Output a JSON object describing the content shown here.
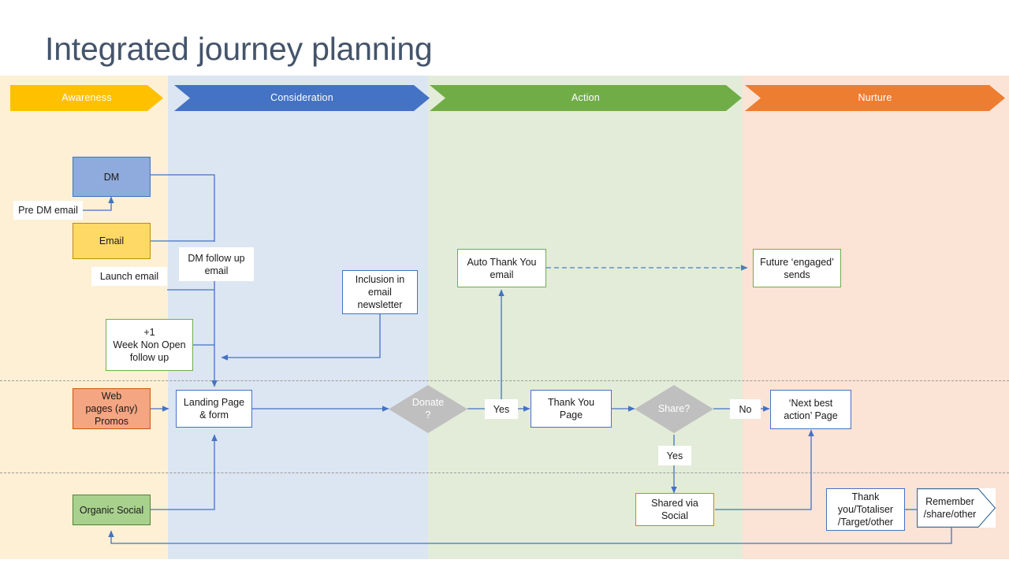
{
  "page": {
    "title": "Integrated journey planning",
    "title_color": "#44546a"
  },
  "phases": [
    {
      "label": "Awareness",
      "color": "#ffc000",
      "band_color": "#fdf0d4"
    },
    {
      "label": "Consideration",
      "color": "#4472c4",
      "band_color": "#dce6f2"
    },
    {
      "label": "Action",
      "color": "#70ad47",
      "band_color": "#e3ecd9"
    },
    {
      "label": "Nurture",
      "color": "#ed7d31",
      "band_color": "#fbe3d5"
    }
  ],
  "nodes": {
    "dm": "DM",
    "pre_dm_email": "Pre DM email",
    "email": "Email",
    "launch_email": "Launch email",
    "dm_follow_up_email": "DM follow up\nemail",
    "week_non_open": "+1\nWeek Non Open\nfollow up",
    "inclusion_newsletter": "Inclusion in\nemail\nnewsletter",
    "auto_thank_you_email": "Auto Thank You\nemail",
    "future_engaged_sends": "Future ‘engaged’\nsends",
    "web_pages_promos": "Web\npages (any)\nPromos",
    "landing_page_form": "Landing Page\n& form",
    "donate_decision": "Donate\n?",
    "yes_donate": "Yes",
    "thank_you_page": "Thank You\nPage",
    "share_decision": "Share?",
    "no_share": "No",
    "yes_share": "Yes",
    "next_best_action_page": "‘Next best\naction’ Page",
    "organic_social": "Organic Social",
    "shared_via_social": "Shared via\nSocial",
    "thank_you_totaliser": "Thank\nyou/Totaliser\n/Target/other",
    "remember_share_other": "Remember\n/share/other"
  },
  "colors": {
    "connector": "#4472c4",
    "connector_muted": "#5b83c0",
    "decision_fill": "#bfbfbf",
    "node_border": "#41719c",
    "green_border": "#70ad47",
    "gold_border": "#bf9000",
    "blue_fill": "#8faadc",
    "amber_fill": "#ffd966",
    "orange_fill": "#f4a582",
    "green_fill": "#a9d18e"
  }
}
